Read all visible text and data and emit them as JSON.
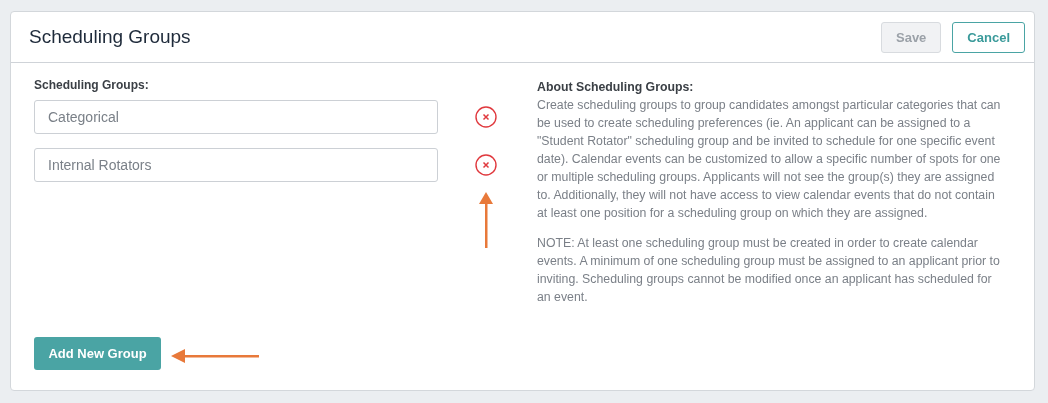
{
  "header": {
    "title": "Scheduling Groups",
    "buttons": [
      {
        "label": "Save",
        "disabled": true
      },
      {
        "label": "Cancel",
        "disabled": false
      }
    ]
  },
  "groups": {
    "label": "Scheduling Groups:",
    "items": [
      {
        "value": "Categorical"
      },
      {
        "value": "Internal Rotators"
      }
    ],
    "add_button": "Add New Group"
  },
  "about": {
    "title": "About Scheduling Groups:",
    "paragraphs": [
      "Create scheduling groups to group candidates amongst particular categories that can be used to create scheduling preferences (ie. An applicant can be assigned to a \"Student Rotator\" scheduling group and be invited to schedule for one specific event date). Calendar events can be customized to allow a specific number of spots for one or multiple scheduling groups. Applicants will not see the group(s) they are assigned to. Additionally, they will not have access to view calendar events that do not contain at least one position for a scheduling group on which they are assigned.",
      "NOTE: At least one scheduling group must be created in order to create calendar events. A minimum of one scheduling group must be assigned to an applicant prior to inviting. Scheduling groups cannot be modified once an applicant has scheduled for an event."
    ]
  }
}
